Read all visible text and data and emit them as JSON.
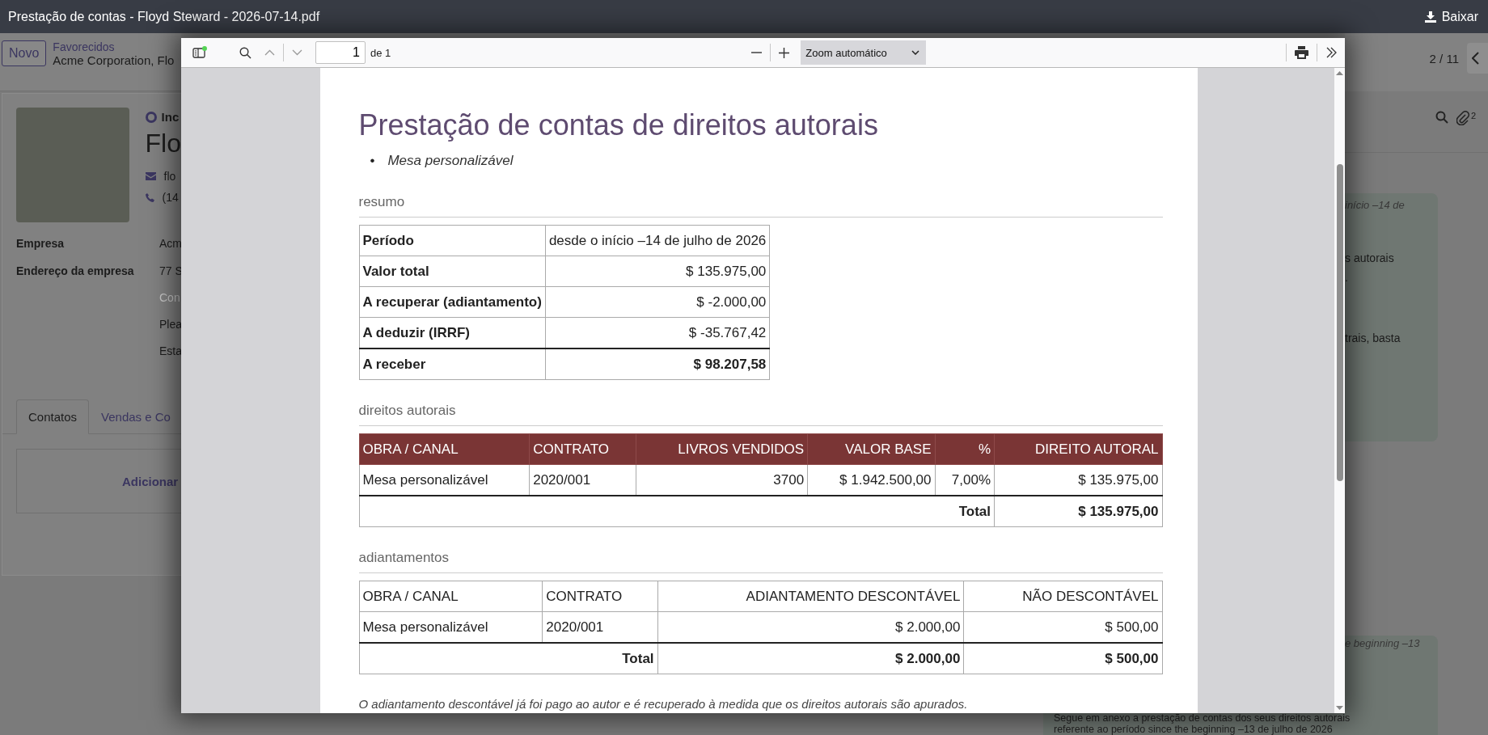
{
  "window": {
    "title": "Prestação de contas - Floyd Steward - 2026-07-14.pdf",
    "download_label": "Baixar"
  },
  "background": {
    "form_header": {
      "new_button": "Novo",
      "breadcrumb_parent": "Favorecidos",
      "breadcrumb_current": "Acme Corporation, Flo",
      "pager": "2 / 11"
    },
    "contact": {
      "type_option": "Inc",
      "type_checked": true,
      "name": "Flo",
      "email": "flo",
      "phone": "(14",
      "fields": [
        {
          "label": "Empresa",
          "values": [
            {
              "kind": "value",
              "text": "Acm"
            }
          ]
        },
        {
          "label": "Endereço da empresa",
          "values": [
            {
              "kind": "value",
              "text": "77 S"
            },
            {
              "kind": "placeholder",
              "text": "Con"
            },
            {
              "kind": "value",
              "text": "Plea"
            },
            {
              "kind": "value",
              "text": "Esta"
            }
          ]
        }
      ]
    },
    "tabs": [
      {
        "label": "Contatos",
        "selected": true
      },
      {
        "label": "Vendas e Co",
        "selected": false
      }
    ],
    "add_link": "Adicionar",
    "chatter": {
      "attachments_count": "2",
      "messages": [
        {
          "date": "início –14 de",
          "lines": [
            "s autorais",
            ".",
            "trais, basta"
          ]
        },
        {
          "date": "e beginning –13",
          "lines": [
            "Segue em anexo a prestação de contas dos seus direitos autorais",
            "referente ao período since the beginning –13 de julho de 2026"
          ]
        }
      ]
    }
  },
  "viewer": {
    "toolbar": {
      "page": "1",
      "page_count": "de 1",
      "zoom": "Zoom automático"
    },
    "document": {
      "title": "Prestação de contas de direitos autorais",
      "items": [
        {
          "marker": "•",
          "text": "Mesa personalizável"
        }
      ],
      "sections": [
        {
          "heading": "resumo",
          "kind": "summary",
          "rows": [
            {
              "label": "Período",
              "value": "desde o início –14 de julho de 2026"
            },
            {
              "label": "Valor total",
              "value": "$ 135.975,00"
            },
            {
              "label": "A recuperar (adiantamento)",
              "value": "$ -2.000,00"
            },
            {
              "label": "A deduzir (IRRF)",
              "value": "$ -35.767,42"
            }
          ],
          "total": {
            "label": "A receber",
            "value": "$ 98.207,58"
          }
        },
        {
          "heading": "direitos autorais",
          "kind": "table",
          "header_filled": true,
          "columns": [
            {
              "label": "OBRA / CANAL",
              "numeric": false
            },
            {
              "label": "CONTRATO",
              "numeric": false
            },
            {
              "label": "LIVROS VENDIDOS",
              "numeric": true
            },
            {
              "label": "VALOR BASE",
              "numeric": true
            },
            {
              "label": "%",
              "numeric": true
            },
            {
              "label": "DIREITO AUTORAL",
              "numeric": true
            }
          ],
          "rows": [
            [
              "Mesa personalizável",
              "2020/001",
              "3700",
              "$ 1.942.500,00",
              "7,00%",
              "$ 135.975,00"
            ]
          ],
          "total": {
            "label": "Total",
            "values": [
              "$ 135.975,00"
            ]
          }
        },
        {
          "heading": "adiantamentos",
          "kind": "table",
          "header_filled": false,
          "columns": [
            {
              "label": "OBRA / CANAL",
              "numeric": false
            },
            {
              "label": "CONTRATO",
              "numeric": false
            },
            {
              "label": "ADIANTAMENTO DESCONTÁVEL",
              "numeric": true
            },
            {
              "label": "NÃO DESCONTÁVEL",
              "numeric": true
            }
          ],
          "rows": [
            [
              "Mesa personalizável",
              "2020/001",
              "$ 2.000,00",
              "$ 500,00"
            ]
          ],
          "total": {
            "label": "Total",
            "values": [
              "$ 2.000,00",
              "$ 500,00"
            ]
          }
        }
      ],
      "note": "O adiantamento descontável já foi pago ao autor e é recuperado à medida que os direitos autorais são apurados."
    }
  }
}
